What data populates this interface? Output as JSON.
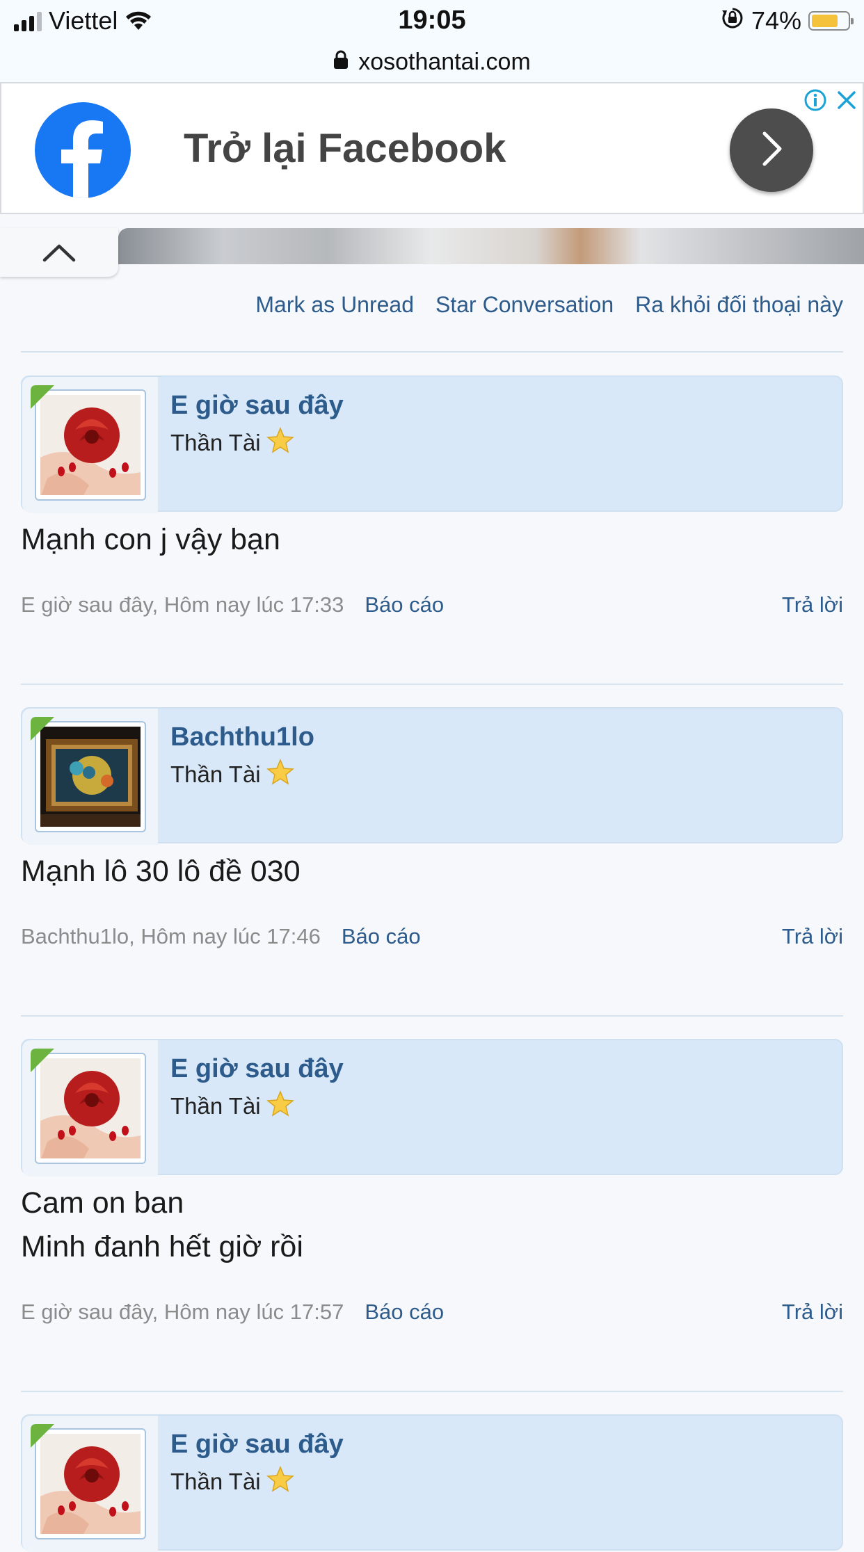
{
  "status_bar": {
    "carrier": "Viettel",
    "time": "19:05",
    "battery_percent": "74%",
    "battery_level": 0.74,
    "signal_bars": 3,
    "icons": [
      "signal-icon",
      "wifi-icon",
      "orientation-lock-icon",
      "battery-icon"
    ]
  },
  "url_bar": {
    "url": "xosothantai.com",
    "icon": "lock-icon"
  },
  "ad": {
    "title": "Trở lại Facebook",
    "brand_color": "#1877f2",
    "icons": [
      "facebook-logo-icon",
      "chevron-right-icon",
      "info-icon",
      "close-icon"
    ]
  },
  "conversation_actions": {
    "mark_unread": "Mark as Unread",
    "star": "Star Conversation",
    "leave": "Ra khỏi đối thoại này"
  },
  "messages": [
    {
      "username": "E giờ sau đây",
      "user_title": "Thần Tài",
      "avatar": "rose-hands",
      "lines": [
        "Mạnh con j vậy bạn"
      ],
      "meta": "E giờ sau đây, Hôm nay lúc 17:33",
      "report": "Báo cáo",
      "reply": "Trả lời"
    },
    {
      "username": "Bachthu1lo",
      "user_title": "Thần Tài",
      "avatar": "framed-painting",
      "lines": [
        "Mạnh lô 30 lô đề 030"
      ],
      "meta": "Bachthu1lo, Hôm nay lúc 17:46",
      "report": "Báo cáo",
      "reply": "Trả lời"
    },
    {
      "username": "E giờ sau đây",
      "user_title": "Thần Tài",
      "avatar": "rose-hands",
      "lines": [
        "Cam on ban",
        "Minh đanh hết giờ rồi"
      ],
      "meta": "E giờ sau đây, Hôm nay lúc 17:57",
      "report": "Báo cáo",
      "reply": "Trả lời"
    },
    {
      "username": "E giờ sau đây",
      "user_title": "Thần Tài",
      "avatar": "rose-hands"
    }
  ],
  "colors": {
    "link": "#2d5b8b",
    "message_header": "#d8e8f8",
    "online_flag": "#6db33f",
    "page_background": "#f7f8fb"
  }
}
